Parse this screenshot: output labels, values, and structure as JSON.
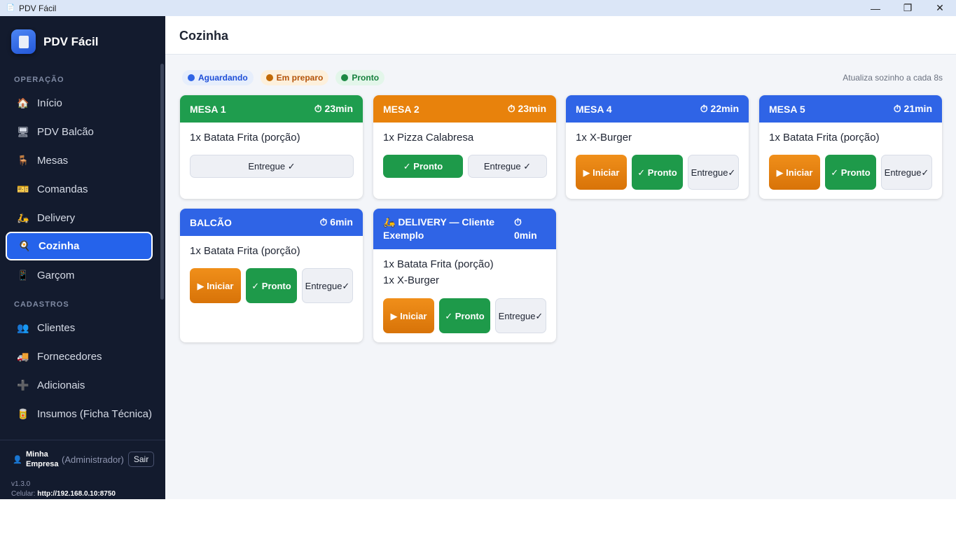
{
  "window": {
    "title": "PDV Fácil",
    "minimize": "—",
    "maximize": "❐",
    "close": "✕"
  },
  "sidebar": {
    "brand": "PDV Fácil",
    "sections": [
      {
        "label": "OPERAÇÃO"
      },
      {
        "label": "CADASTROS"
      }
    ],
    "items": [
      {
        "label": "Início",
        "icon": "🏠"
      },
      {
        "label": "PDV Balcão",
        "icon": "🖥"
      },
      {
        "label": "Mesas",
        "icon": "🪑"
      },
      {
        "label": "Comandas",
        "icon": "🎫"
      },
      {
        "label": "Delivery",
        "icon": "🛵"
      },
      {
        "label": "Cozinha",
        "icon": "🍳"
      },
      {
        "label": "Garçom",
        "icon": "📱"
      },
      {
        "label": "Clientes",
        "icon": "👥"
      },
      {
        "label": "Fornecedores",
        "icon": "🚚"
      },
      {
        "label": "Adicionais",
        "icon": "➕"
      },
      {
        "label": "Insumos (Ficha Técnica)",
        "icon": "🥫"
      }
    ],
    "user": {
      "name": "Minha Empresa",
      "role": "(Administrador)",
      "logout": "Sair"
    },
    "version": "v1.3.0",
    "mobile_label": "Celular:",
    "mobile_url": "http://192.168.0.10:8750"
  },
  "main": {
    "title": "Cozinha",
    "legend": [
      {
        "label": "Aguardando",
        "color": "#2f64e6",
        "bg": "#e6eefc",
        "text": "#1d4ed8"
      },
      {
        "label": "Em preparo",
        "color": "#c26a06",
        "bg": "#fdf0dc",
        "text": "#b45309"
      },
      {
        "label": "Pronto",
        "color": "#1e8a44",
        "bg": "#e3f6ea",
        "text": "#15803d"
      }
    ],
    "refresh_note": "Atualiza sozinho a cada 8s",
    "orders": [
      {
        "title": "MESA 1",
        "timer": "⏱ 23min",
        "items": [
          "1x Batata Frita (porção)"
        ]
      },
      {
        "title": "MESA 2",
        "timer": "⏱ 23min",
        "items": [
          "1x Pizza Calabresa"
        ]
      },
      {
        "title": "MESA 4",
        "timer": "⏱ 22min",
        "items": [
          "1x X-Burger"
        ]
      },
      {
        "title": "MESA 5",
        "timer": "⏱ 21min",
        "items": [
          "1x Batata Frita (porção)"
        ]
      },
      {
        "title": "BALCÃO",
        "timer": "⏱ 6min",
        "items": [
          "1x Batata Frita (porção)"
        ]
      },
      {
        "title": "🛵 DELIVERY — Cliente Exemplo",
        "timer_icon": "⏱",
        "timer_value": "0min",
        "items": [
          "1x Batata Frita (porção)",
          "1x X-Burger"
        ]
      }
    ],
    "buttons": {
      "start": "▶ Iniciar",
      "ready": "✓ Pronto",
      "delivered": "Entregue ✓",
      "delivered_a": "Entregue",
      "delivered_b": "✓"
    }
  }
}
